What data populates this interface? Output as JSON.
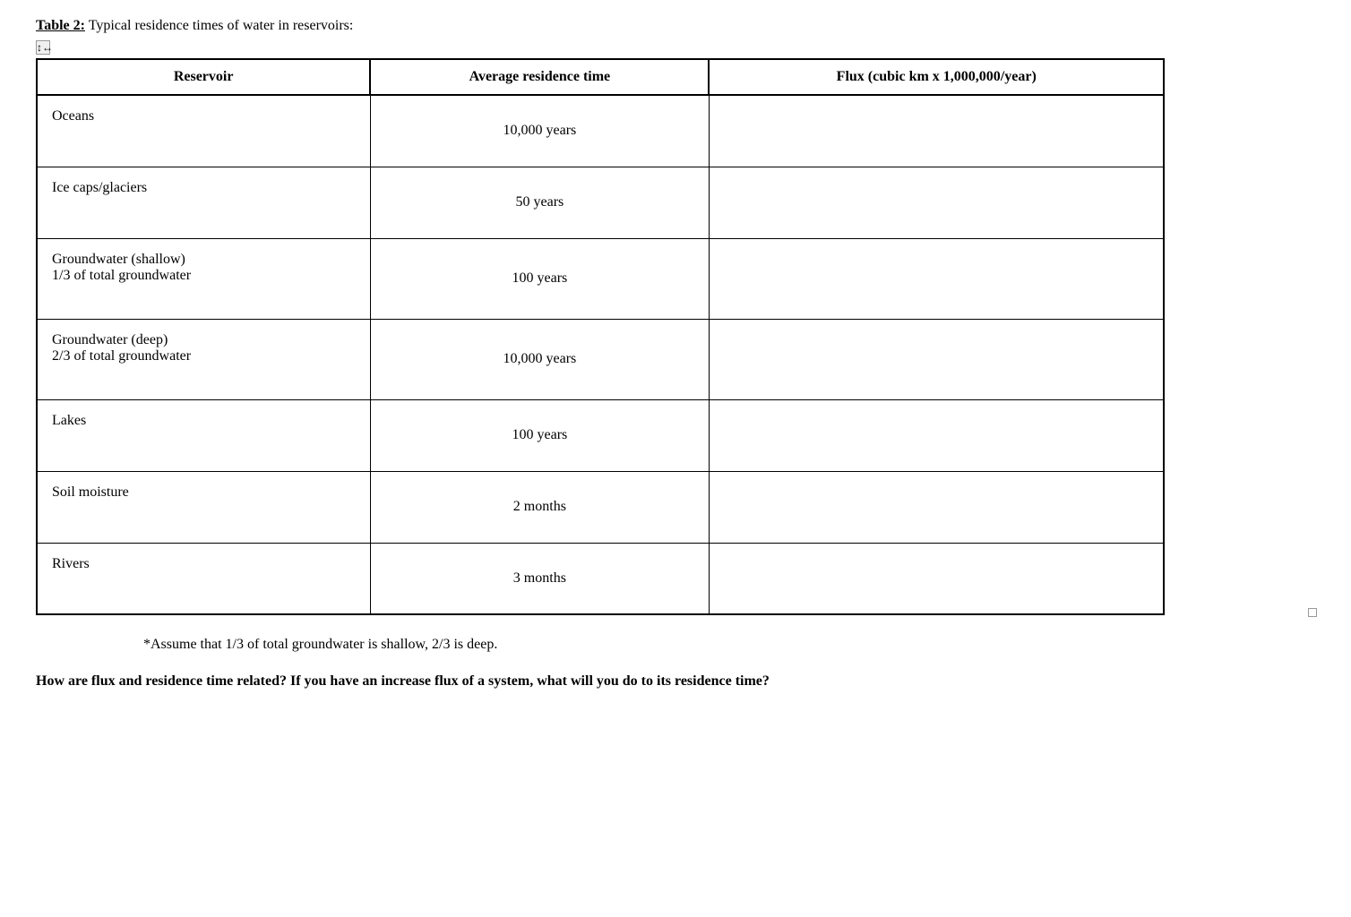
{
  "table_title": {
    "bold_part": "Table 2:",
    "normal_part": " Typical residence times of water in reservoirs:"
  },
  "headers": {
    "col1": "Reservoir",
    "col2": "Average residence time",
    "col3": "Flux (cubic km x 1,000,000/year)"
  },
  "rows": [
    {
      "reservoir": "Oceans",
      "reservoir_sub": "",
      "time": "10,000 years",
      "flux": ""
    },
    {
      "reservoir": "Ice caps/glaciers",
      "reservoir_sub": "",
      "time": "50 years",
      "flux": ""
    },
    {
      "reservoir": "Groundwater (shallow)",
      "reservoir_sub": " 1/3 of total groundwater",
      "time": "100 years",
      "flux": ""
    },
    {
      "reservoir": "Groundwater (deep)",
      "reservoir_sub": " 2/3 of total groundwater",
      "time": "10,000 years",
      "flux": ""
    },
    {
      "reservoir": "Lakes",
      "reservoir_sub": "",
      "time": "100 years",
      "flux": ""
    },
    {
      "reservoir": "Soil moisture",
      "reservoir_sub": "",
      "time": "2 months",
      "flux": ""
    },
    {
      "reservoir": "Rivers",
      "reservoir_sub": "",
      "time": "3 months",
      "flux": ""
    }
  ],
  "note": "*Assume that 1/3 of total groundwater is shallow, 2/3 is deep.",
  "question": "How are flux and residence time related? If you have an increase flux of a system, what will you do to its residence time?"
}
